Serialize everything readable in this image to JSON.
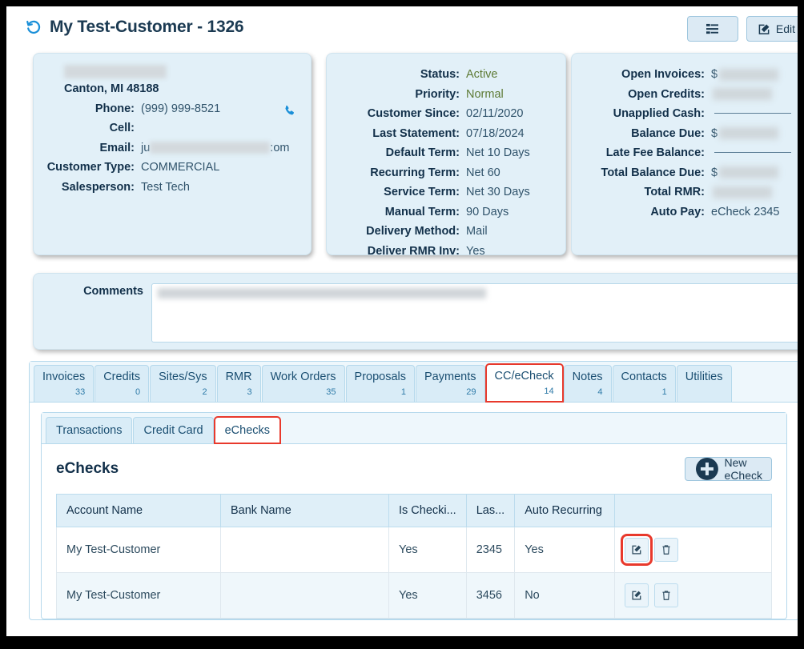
{
  "header": {
    "title": "My Test-Customer - 1326",
    "history_icon": "history-icon",
    "list_button_label": "",
    "edit_button_label": "Edit"
  },
  "contact_card": {
    "name_redacted": "",
    "address": "Canton, MI 48188",
    "rows": [
      {
        "label": "Phone:",
        "value": "(999) 999-8521"
      },
      {
        "label": "Cell:",
        "value": ""
      },
      {
        "label": "Email:",
        "value_prefix": "ju",
        "value_suffix": ":om"
      },
      {
        "label": "Customer Type:",
        "value": "COMMERCIAL"
      },
      {
        "label": "Salesperson:",
        "value": "Test Tech"
      }
    ]
  },
  "status_card": {
    "rows": [
      {
        "label": "Status:",
        "value": "Active",
        "style": "green"
      },
      {
        "label": "Priority:",
        "value": "Normal",
        "style": "green"
      },
      {
        "label": "Customer Since:",
        "value": "02/11/2020"
      },
      {
        "label": "Last Statement:",
        "value": "07/18/2024"
      },
      {
        "label": "Default Term:",
        "value": "Net 10 Days"
      },
      {
        "label": "Recurring Term:",
        "value": "Net 60"
      },
      {
        "label": "Service Term:",
        "value": "Net 30 Days"
      },
      {
        "label": "Manual Term:",
        "value": "90 Days"
      },
      {
        "label": "Delivery Method:",
        "value": "Mail"
      },
      {
        "label": "Deliver RMR Inv:",
        "value": "Yes"
      }
    ]
  },
  "finance_card": {
    "rows": [
      {
        "label": "Open Invoices:",
        "value": "$",
        "redacted": true
      },
      {
        "label": "Open Credits:",
        "value": "",
        "redacted": true
      },
      {
        "label": "Unapplied Cash:",
        "value": "",
        "redacted": true,
        "rule": true
      },
      {
        "label": "Balance Due:",
        "value": "$",
        "redacted": true
      },
      {
        "label": "Late Fee Balance:",
        "value": "",
        "redacted": true,
        "rule": true
      },
      {
        "label": "Total Balance Due:",
        "value": "$",
        "redacted": true
      },
      {
        "label": "Total RMR:",
        "value": "",
        "redacted": true
      },
      {
        "label": "Auto Pay:",
        "value": "eCheck 2345",
        "redacted": false
      }
    ]
  },
  "comments": {
    "label": "Comments",
    "value_redacted": ""
  },
  "tabs": [
    {
      "label": "Invoices",
      "count": "33",
      "active": false,
      "highlighted": false
    },
    {
      "label": "Credits",
      "count": "0",
      "active": false,
      "highlighted": false
    },
    {
      "label": "Sites/Sys",
      "count": "2",
      "active": false,
      "highlighted": false
    },
    {
      "label": "RMR",
      "count": "3",
      "active": false,
      "highlighted": false
    },
    {
      "label": "Work Orders",
      "count": "35",
      "active": false,
      "highlighted": false
    },
    {
      "label": "Proposals",
      "count": "1",
      "active": false,
      "highlighted": false
    },
    {
      "label": "Payments",
      "count": "29",
      "active": false,
      "highlighted": false
    },
    {
      "label": "CC/eCheck",
      "count": "14",
      "active": true,
      "highlighted": true
    },
    {
      "label": "Notes",
      "count": "4",
      "active": false,
      "highlighted": false
    },
    {
      "label": "Contacts",
      "count": "1",
      "active": false,
      "highlighted": false
    },
    {
      "label": "Utilities",
      "count": "",
      "active": false,
      "highlighted": false
    }
  ],
  "subtabs": [
    {
      "label": "Transactions",
      "active": false,
      "highlighted": false
    },
    {
      "label": "Credit Card",
      "active": false,
      "highlighted": false
    },
    {
      "label": "eChecks",
      "active": true,
      "highlighted": true
    }
  ],
  "echecks": {
    "section_title": "eChecks",
    "new_button_label": "New eCheck",
    "columns": [
      "Account Name",
      "Bank Name",
      "Is Checki...",
      "Las...",
      "Auto Recurring",
      ""
    ],
    "rows": [
      {
        "account_name": "My Test-Customer",
        "bank_name": "",
        "is_checking": "Yes",
        "last4": "2345",
        "auto_recurring": "Yes",
        "edit_highlighted": true
      },
      {
        "account_name": "My Test-Customer",
        "bank_name": "",
        "is_checking": "Yes",
        "last4": "3456",
        "auto_recurring": "No",
        "edit_highlighted": false
      }
    ]
  },
  "colors": {
    "accent_blue": "#1a8fd8",
    "highlight_red": "#e8392c",
    "card_bg": "#e2f0f8",
    "status_green": "#5d7a35",
    "title_navy": "#1b3a52"
  }
}
